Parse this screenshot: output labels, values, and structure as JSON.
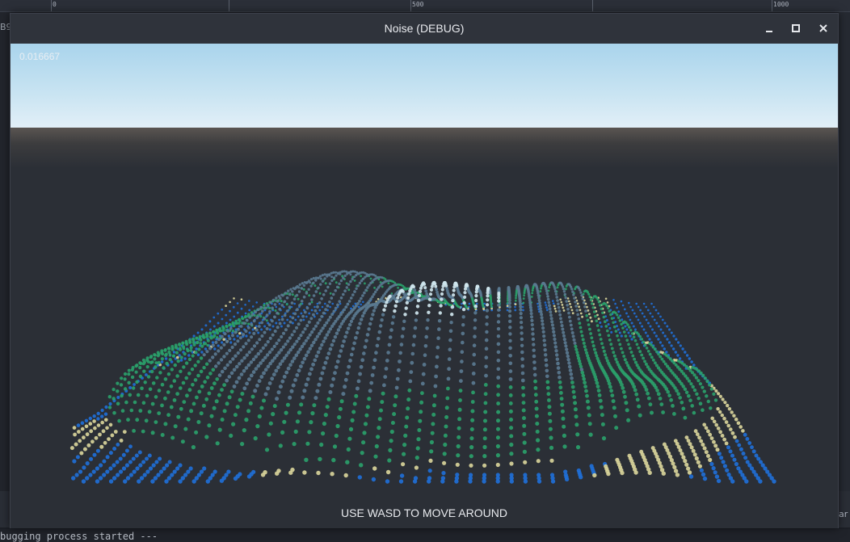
{
  "editor": {
    "ruler_labels": [
      "0",
      "500",
      "1000"
    ],
    "left_fragment": "B9",
    "left_bottom_fragment": "",
    "right_fragment": "ar",
    "console_text": "bugging process started ---"
  },
  "window": {
    "title": "Noise (DEBUG)",
    "controls": {
      "minimize": "minimize-icon",
      "maximize": "maximize-icon",
      "close": "close-icon"
    }
  },
  "viewport": {
    "frame_time": "0.016667",
    "instructions": "USE WASD TO MOVE AROUND",
    "colors": {
      "water": "#1f6fd6",
      "sand": "#d8d49a",
      "grass": "#2aa06a",
      "rock": "#5a7a90",
      "snow": "#cfe6ee",
      "sky": "#bfe0f1"
    }
  }
}
